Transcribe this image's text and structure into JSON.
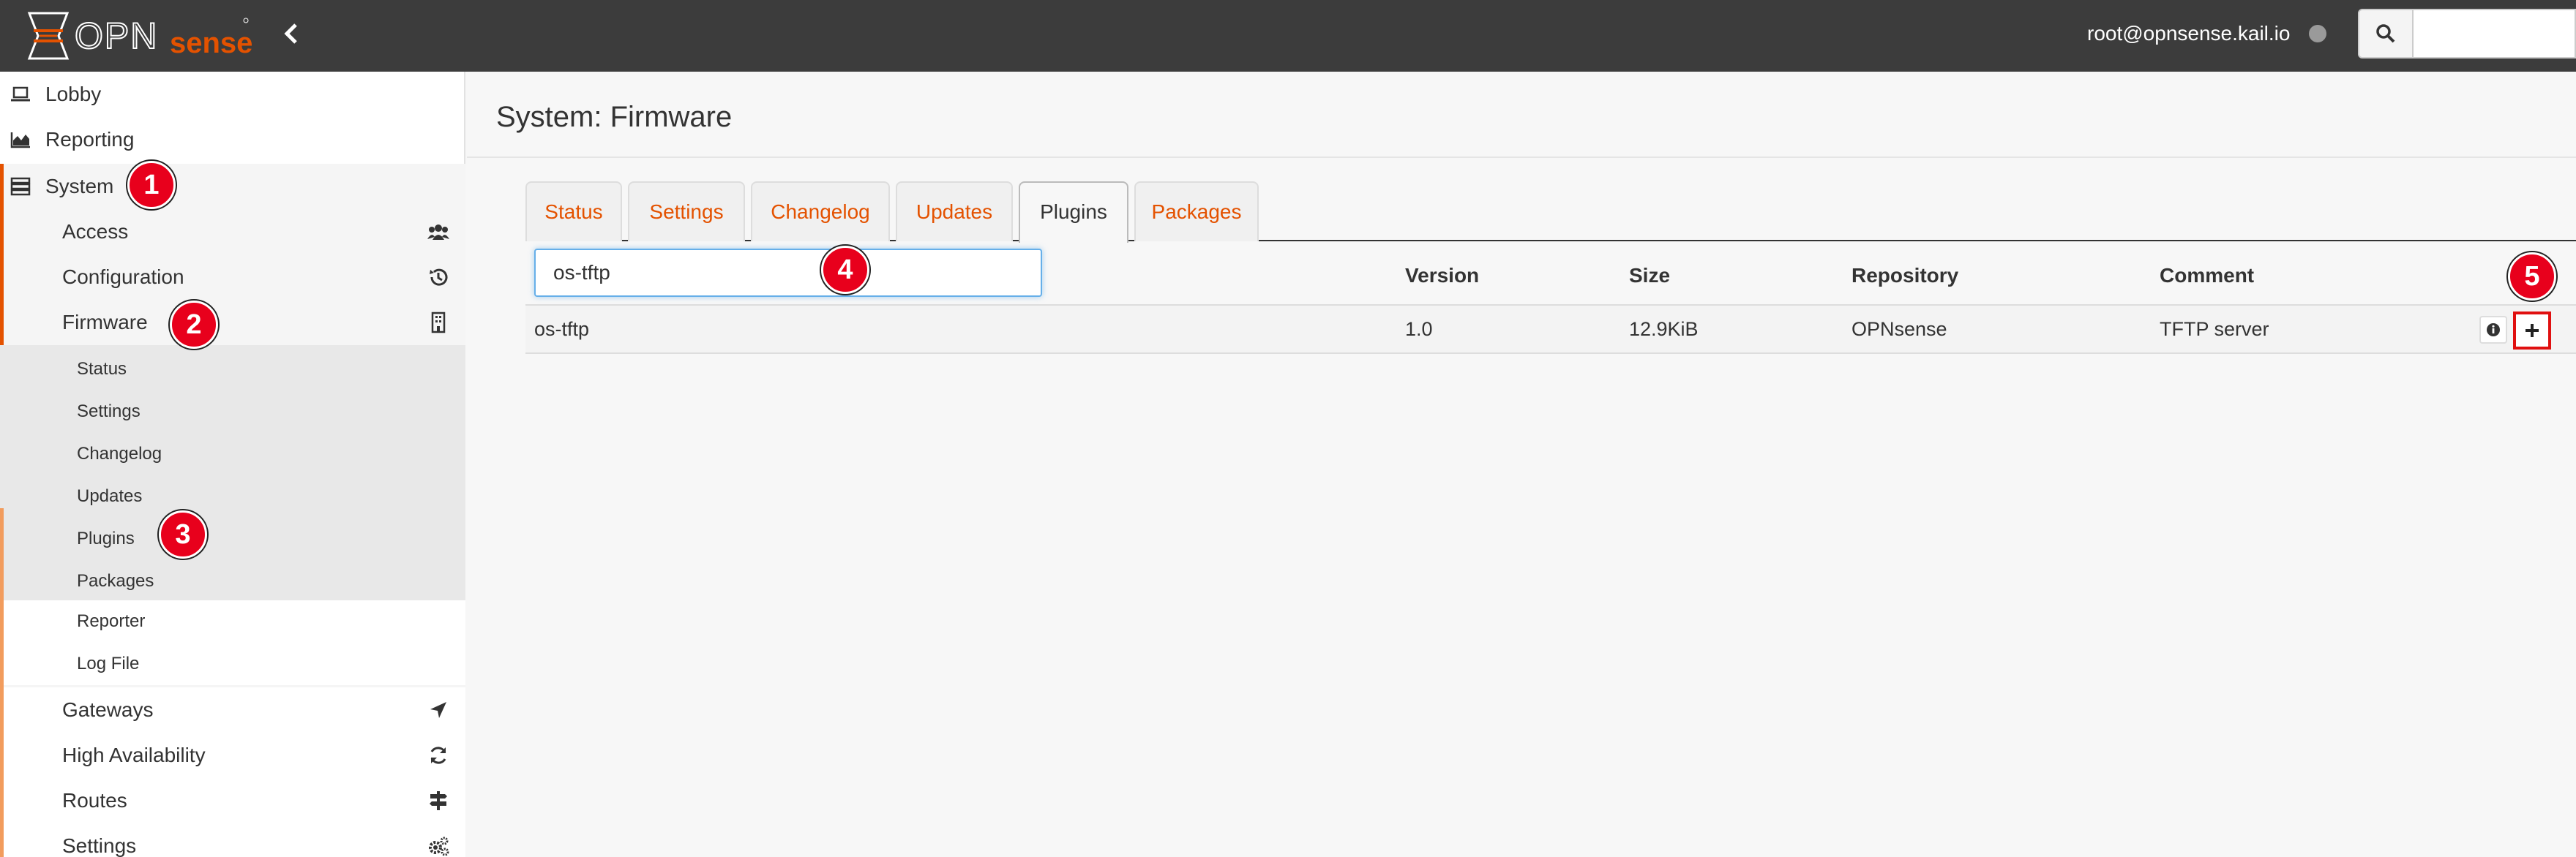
{
  "header": {
    "logo_text": "OPNsense",
    "user": "root@opnsense.kail.io",
    "search_placeholder": ""
  },
  "sidebar": {
    "top_items": [
      {
        "label": "Lobby",
        "icon": "laptop-icon"
      },
      {
        "label": "Reporting",
        "icon": "area-chart-icon"
      },
      {
        "label": "System",
        "icon": "server-icon"
      }
    ],
    "system_items": [
      {
        "label": "Access",
        "icon": "users-icon"
      },
      {
        "label": "Configuration",
        "icon": "history-icon"
      },
      {
        "label": "Firmware",
        "icon": "building-icon"
      }
    ],
    "firmware_items": [
      "Status",
      "Settings",
      "Changelog",
      "Updates",
      "Plugins",
      "Packages"
    ],
    "extra_items": [
      "Reporter",
      "Log File"
    ],
    "lower_items": [
      {
        "label": "Gateways",
        "icon": "location-arrow-icon"
      },
      {
        "label": "High Availability",
        "icon": "refresh-icon"
      },
      {
        "label": "Routes",
        "icon": "map-signs-icon"
      },
      {
        "label": "Settings",
        "icon": "cogs-icon"
      }
    ]
  },
  "page": {
    "title": "System: Firmware",
    "tabs": [
      "Status",
      "Settings",
      "Changelog",
      "Updates",
      "Plugins",
      "Packages"
    ],
    "active_tab": "Plugins"
  },
  "grid": {
    "filter_value": "os-tftp",
    "columns": [
      "Version",
      "Size",
      "Repository",
      "Comment"
    ],
    "rows": [
      {
        "name": "os-tftp",
        "version": "1.0",
        "size": "12.9KiB",
        "repository": "OPNsense",
        "comment": "TFTP server"
      }
    ]
  },
  "annotations": [
    "1",
    "2",
    "3",
    "4",
    "5"
  ],
  "colors": {
    "accent": "#e45200",
    "topbar": "#3c3c3c",
    "badge": "#e8001c"
  }
}
